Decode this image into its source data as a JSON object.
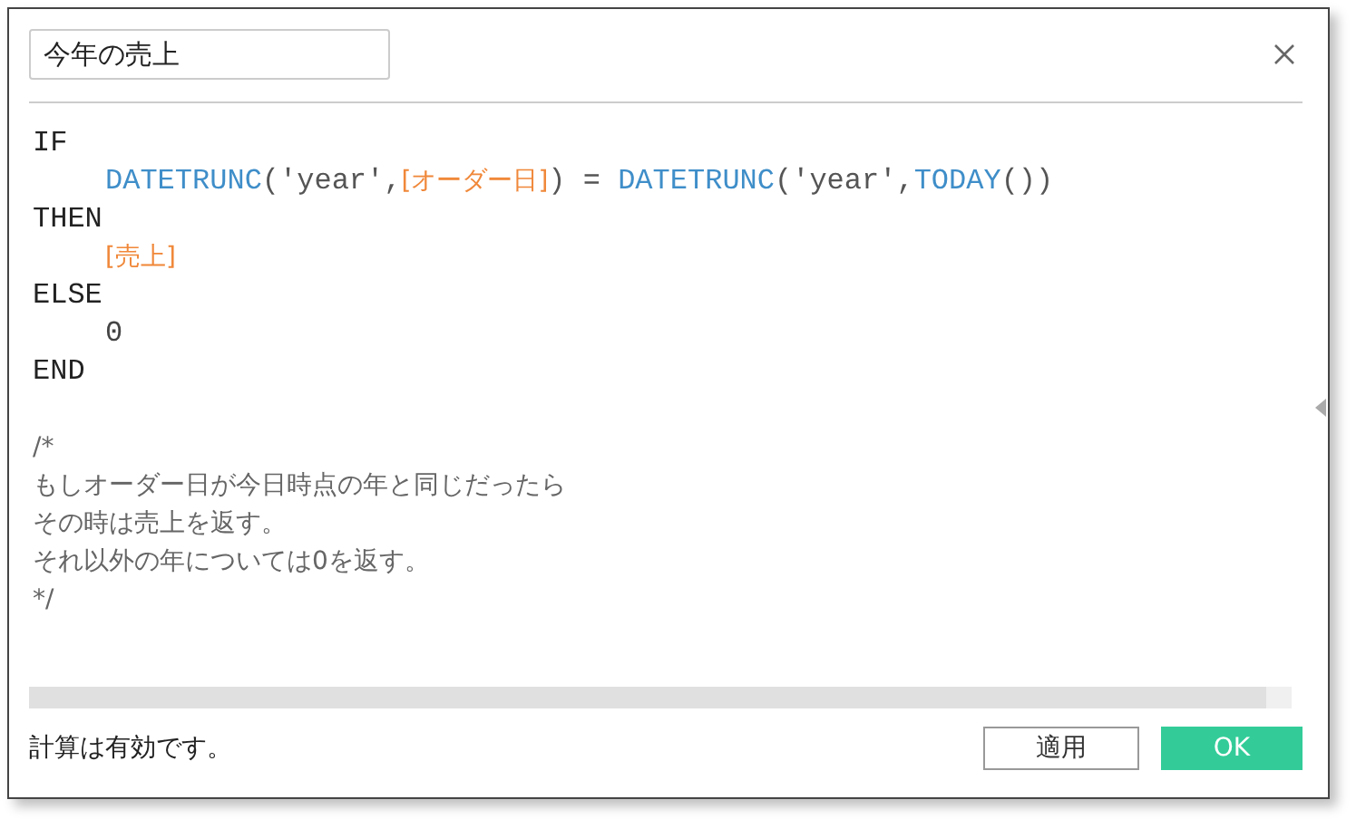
{
  "title_field": {
    "value": "今年の売上"
  },
  "code_lines": [
    {
      "indented": false,
      "tokens": [
        {
          "kind": "keyword",
          "text": "IF"
        }
      ]
    },
    {
      "indented": true,
      "tokens": [
        {
          "kind": "function",
          "text": "DATETRUNC"
        },
        {
          "kind": "punct",
          "text": "('year',"
        },
        {
          "kind": "field",
          "text": "[オーダー日]"
        },
        {
          "kind": "punct",
          "text": ") = "
        },
        {
          "kind": "function",
          "text": "DATETRUNC"
        },
        {
          "kind": "punct",
          "text": "('year',"
        },
        {
          "kind": "function",
          "text": "TODAY"
        },
        {
          "kind": "punct",
          "text": "())"
        }
      ]
    },
    {
      "indented": false,
      "tokens": [
        {
          "kind": "keyword",
          "text": "THEN"
        }
      ]
    },
    {
      "indented": true,
      "tokens": [
        {
          "kind": "field",
          "text": "[売上]"
        }
      ]
    },
    {
      "indented": false,
      "tokens": [
        {
          "kind": "keyword",
          "text": "ELSE"
        }
      ]
    },
    {
      "indented": true,
      "tokens": [
        {
          "kind": "number",
          "text": "0"
        }
      ]
    },
    {
      "indented": false,
      "tokens": [
        {
          "kind": "keyword",
          "text": "END"
        }
      ]
    }
  ],
  "comment_lines": [
    "/*",
    "もしオーダー日が今日時点の年と同じだったら",
    "その時は売上を返す。",
    "それ以外の年については0を返す。",
    "*/"
  ],
  "status": "計算は有効です。",
  "buttons": [
    {
      "label": "適用",
      "kind": "secondary"
    },
    {
      "label": "OK",
      "kind": "primary"
    }
  ]
}
